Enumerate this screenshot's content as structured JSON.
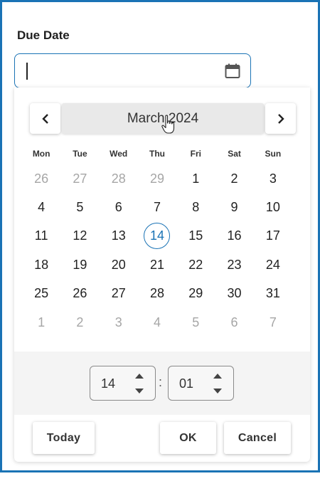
{
  "field": {
    "label": "Due Date",
    "value": ""
  },
  "icons": {
    "calendar": "calendar-icon",
    "prev": "chevron-left-icon",
    "next": "chevron-right-icon",
    "cursor": "hand-pointer-icon"
  },
  "calendar": {
    "month_title": "March 2024",
    "weekdays": [
      "Mon",
      "Tue",
      "Wed",
      "Thu",
      "Fri",
      "Sat",
      "Sun"
    ],
    "days": [
      {
        "d": "26",
        "muted": true
      },
      {
        "d": "27",
        "muted": true
      },
      {
        "d": "28",
        "muted": true
      },
      {
        "d": "29",
        "muted": true
      },
      {
        "d": "1"
      },
      {
        "d": "2"
      },
      {
        "d": "3"
      },
      {
        "d": "4"
      },
      {
        "d": "5"
      },
      {
        "d": "6"
      },
      {
        "d": "7"
      },
      {
        "d": "8"
      },
      {
        "d": "9"
      },
      {
        "d": "10"
      },
      {
        "d": "11"
      },
      {
        "d": "12"
      },
      {
        "d": "13"
      },
      {
        "d": "14",
        "today": true
      },
      {
        "d": "15"
      },
      {
        "d": "16"
      },
      {
        "d": "17"
      },
      {
        "d": "18"
      },
      {
        "d": "19"
      },
      {
        "d": "20"
      },
      {
        "d": "21"
      },
      {
        "d": "22"
      },
      {
        "d": "23"
      },
      {
        "d": "24"
      },
      {
        "d": "25"
      },
      {
        "d": "26"
      },
      {
        "d": "27"
      },
      {
        "d": "28"
      },
      {
        "d": "29"
      },
      {
        "d": "30"
      },
      {
        "d": "31"
      },
      {
        "d": "1",
        "muted": true
      },
      {
        "d": "2",
        "muted": true
      },
      {
        "d": "3",
        "muted": true
      },
      {
        "d": "4",
        "muted": true
      },
      {
        "d": "5",
        "muted": true
      },
      {
        "d": "6",
        "muted": true
      },
      {
        "d": "7",
        "muted": true
      }
    ]
  },
  "time": {
    "hours": "14",
    "minutes": "01",
    "separator": ":"
  },
  "buttons": {
    "today": "Today",
    "ok": "OK",
    "cancel": "Cancel"
  },
  "colors": {
    "accent": "#1a73b5",
    "muted_text": "#a6a6a6",
    "title_bg": "#e9e9e9"
  }
}
